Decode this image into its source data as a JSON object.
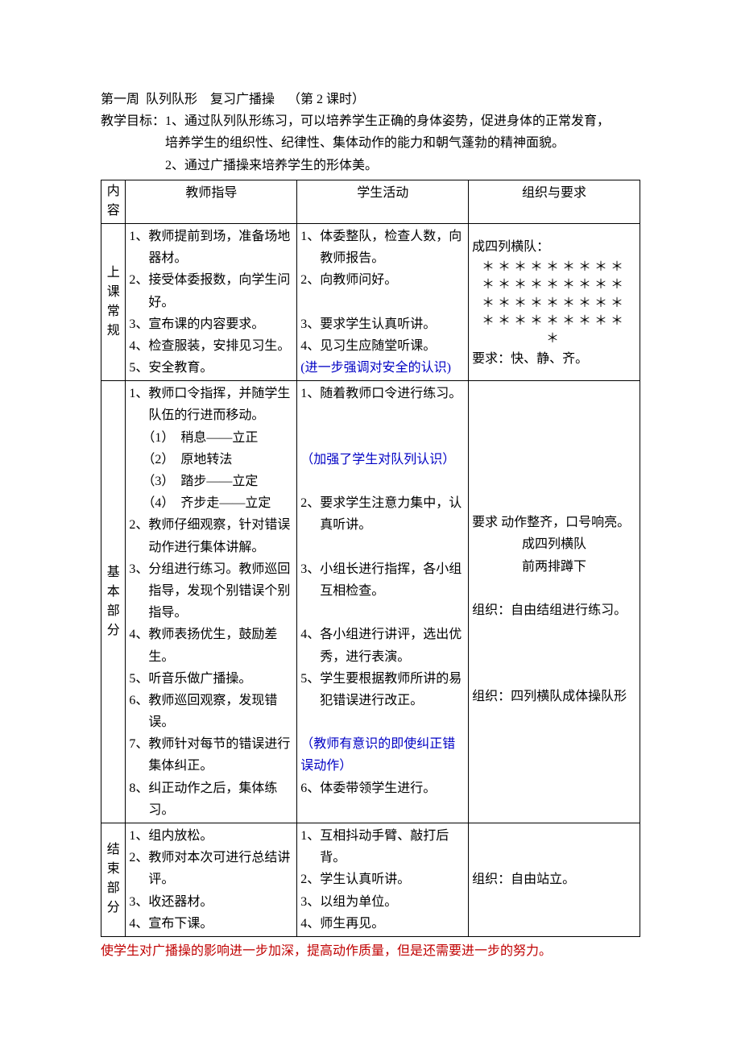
{
  "header": {
    "title_line": "第一周  队列队形    复习广播操    （第 2 课时）",
    "goal_prefix": "教学目标：",
    "goal_1a": "1、通过队列队形练习，可以培养学生正确的身体姿势，促进身体的正常发育，",
    "goal_1b": "培养学生的组织性、纪律性、集体动作的能力和朝气蓬勃的精神面貌。",
    "goal_2": "2、通过广播操来培养学生的形体美。"
  },
  "table": {
    "col_headers": {
      "c1": "内容",
      "c2": "教师指导",
      "c3": "学生活动",
      "c4": "组织与要求"
    },
    "row_labels": {
      "r1": "上课常规",
      "r2": "基本部分",
      "r3": "结束部分"
    },
    "r1": {
      "teacher": {
        "i1_num": "1、",
        "i1_txt": "教师提前到场，准备场地器材。",
        "i2_num": "2、",
        "i2_txt": "接受体委报数，向学生问好。",
        "i3_num": "3、",
        "i3_txt": "宣布课的内容要求。",
        "i4_num": "4、",
        "i4_txt": "检查服装，安排见习生。",
        "i5_num": "5、",
        "i5_txt": "安全教育。"
      },
      "student": {
        "i1_num": "1、",
        "i1_txt": "体委整队，检查人数，向教师报告。",
        "i2_num": "2、",
        "i2_txt": "向教师问好。",
        "i3_num": "3、",
        "i3_txt": "要求学生认真听讲。",
        "i4_num": "4、",
        "i4_txt": "见习生应随堂听课。",
        "note": "(进一步强调对安全的认识)"
      },
      "org": {
        "line1": "成四列横队：",
        "stars1": "＊＊＊＊＊＊＊＊＊",
        "stars2": "＊＊＊＊＊＊＊＊＊",
        "stars3": "＊＊＊＊＊＊＊＊＊",
        "stars4": "＊＊＊＊＊＊＊＊＊",
        "stars5": "＊",
        "line2": "要求：快、静、齐。"
      }
    },
    "r2": {
      "teacher": {
        "i1_num": "1、",
        "i1_txt": "教师口令指挥，并随学生队伍的行进而移动。",
        "s1": "（1）　稍息——立正",
        "s2": "（2）　原地转法",
        "s3": "（3）　踏步——立定",
        "s4": "（4）　齐步走——立定",
        "i2_num": "2、",
        "i2_txt": "教师仔细观察，针对错误动作进行集体讲解。",
        "i3_num": "3、",
        "i3_txt": "分组进行练习。教师巡回指导，发现个别错误个别指导。",
        "i4_num": "4、",
        "i4_txt": "教师表扬优生，鼓励差生。",
        "i5_num": "5、",
        "i5_txt": "听音乐做广播操。",
        "i6_num": "6、",
        "i6_txt": "教师巡回观察，发现错误。",
        "i7_num": "7、",
        "i7_txt": "教师针对每节的错误进行集体纠正。",
        "i8_num": "8、",
        "i8_txt": "纠正动作之后，集体练习。"
      },
      "student": {
        "i1_num": "1、",
        "i1_txt": "随着教师口令进行练习。",
        "note1": "（加强了学生对队列认识）",
        "i2_num": "2、",
        "i2_txt": "要求学生注意力集中，认真听讲。",
        "i3_num": "3、",
        "i3_txt": "小组长进行指挥，各小组互相检查。",
        "i4_num": "4、",
        "i4_txt": "各小组进行讲评，选出优秀，进行表演。",
        "i5_num": "5、",
        "i5_txt": "学生要根据教师所讲的易犯错误进行改正。",
        "note2": "（教师有意识的即使纠正错误动作）",
        "i6_num": "6、",
        "i6_txt": "体委带领学生进行。"
      },
      "org": {
        "line1": "要求 动作整齐，口号响亮。",
        "line2": "成四列横队",
        "line3": "前两排蹲下",
        "line4": "组织：自由结组进行练习。",
        "line5": "组织：四列横队成体操队形"
      }
    },
    "r3": {
      "teacher": {
        "i1_num": "1、",
        "i1_txt": "组内放松。",
        "i2_num": "2、",
        "i2_txt": "教师对本次可进行总结讲评。",
        "i3_num": "3、",
        "i3_txt": "收还器材。",
        "i4_num": "4、",
        "i4_txt": "宣布下课。"
      },
      "student": {
        "i1_num": "1、",
        "i1_txt": "互相抖动手臂、敲打后背。",
        "i2_num": "2、",
        "i2_txt": "学生认真听讲。",
        "i3_num": "3、",
        "i3_txt": "以组为单位。",
        "i4_num": "4、",
        "i4_txt": "师生再见。"
      },
      "org": {
        "line1": "组织：自由站立。"
      }
    }
  },
  "footer_note": "使学生对广播操的影响进一步加深，提高动作质量，但是还需要进一步的努力。"
}
